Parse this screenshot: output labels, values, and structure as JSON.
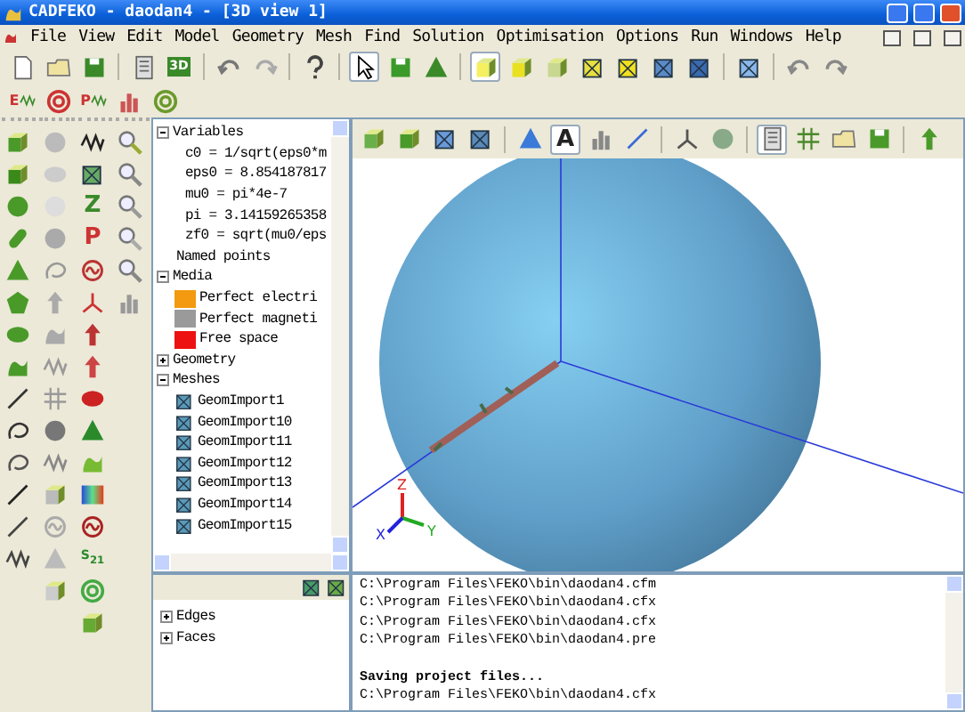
{
  "window": {
    "title": "CADFEKO - daodan4 - [3D view 1]"
  },
  "menu": [
    "File",
    "View",
    "Edit",
    "Model",
    "Geometry",
    "Mesh",
    "Find",
    "Solution",
    "Optimisation",
    "Options",
    "Run",
    "Windows",
    "Help"
  ],
  "toolbar_labels": {
    "view_3d": "3D",
    "field_e": "E",
    "field_p": "P"
  },
  "palette_labels": {
    "z": "Z",
    "p": "P",
    "s21": "S$_{21}$"
  },
  "view_toolbar_labels": {
    "annotation": "A"
  },
  "triad_labels": [
    "X",
    "Y",
    "Z"
  ],
  "tree": [
    {
      "label": "Variables",
      "kind": "folder",
      "expanded": true,
      "children": [
        {
          "label": "c0 = 1/sqrt(eps0*m",
          "kind": "variable"
        },
        {
          "label": "eps0 = 8.854187817",
          "kind": "variable"
        },
        {
          "label": "mu0 = pi*4e-7",
          "kind": "variable"
        },
        {
          "label": "pi = 3.14159265358",
          "kind": "variable"
        },
        {
          "label": "zf0 = sqrt(mu0/eps",
          "kind": "variable"
        }
      ]
    },
    {
      "label": "Named points",
      "kind": "leaf"
    },
    {
      "label": "Media",
      "kind": "folder",
      "expanded": true,
      "children": [
        {
          "label": "Perfect electri",
          "kind": "medium",
          "color": "#f39a10"
        },
        {
          "label": "Perfect magneti",
          "kind": "medium",
          "color": "#9a9a9a"
        },
        {
          "label": "Free space",
          "kind": "medium",
          "color": "#ee1111"
        }
      ]
    },
    {
      "label": "Geometry",
      "kind": "folder",
      "expanded": false
    },
    {
      "label": "Meshes",
      "kind": "folder",
      "expanded": true,
      "children": [
        {
          "label": "GeomImport1",
          "kind": "mesh"
        },
        {
          "label": "GeomImport10",
          "kind": "mesh"
        },
        {
          "label": "GeomImport11",
          "kind": "mesh"
        },
        {
          "label": "GeomImport12",
          "kind": "mesh"
        },
        {
          "label": "GeomImport13",
          "kind": "mesh"
        },
        {
          "label": "GeomImport14",
          "kind": "mesh"
        },
        {
          "label": "GeomImport15",
          "kind": "mesh"
        }
      ]
    }
  ],
  "details_tree": [
    {
      "label": "Edges",
      "expanded": false
    },
    {
      "label": "Faces",
      "expanded": false
    }
  ],
  "output": [
    {
      "text": "C:\\Program Files\\FEKO\\bin\\daodan4.cfm",
      "kind": "path"
    },
    {
      "text": "C:\\Program Files\\FEKO\\bin\\daodan4.cfx",
      "kind": "path"
    },
    {
      "text": "C:\\Program Files\\FEKO\\bin\\daodan4.cfx",
      "kind": "path"
    },
    {
      "text": "C:\\Program Files\\FEKO\\bin\\daodan4.pre",
      "kind": "path"
    },
    {
      "text": "Saving project files...",
      "kind": "heading"
    },
    {
      "text": "C:\\Program Files\\FEKO\\bin\\daodan4.cfx",
      "kind": "path"
    }
  ]
}
